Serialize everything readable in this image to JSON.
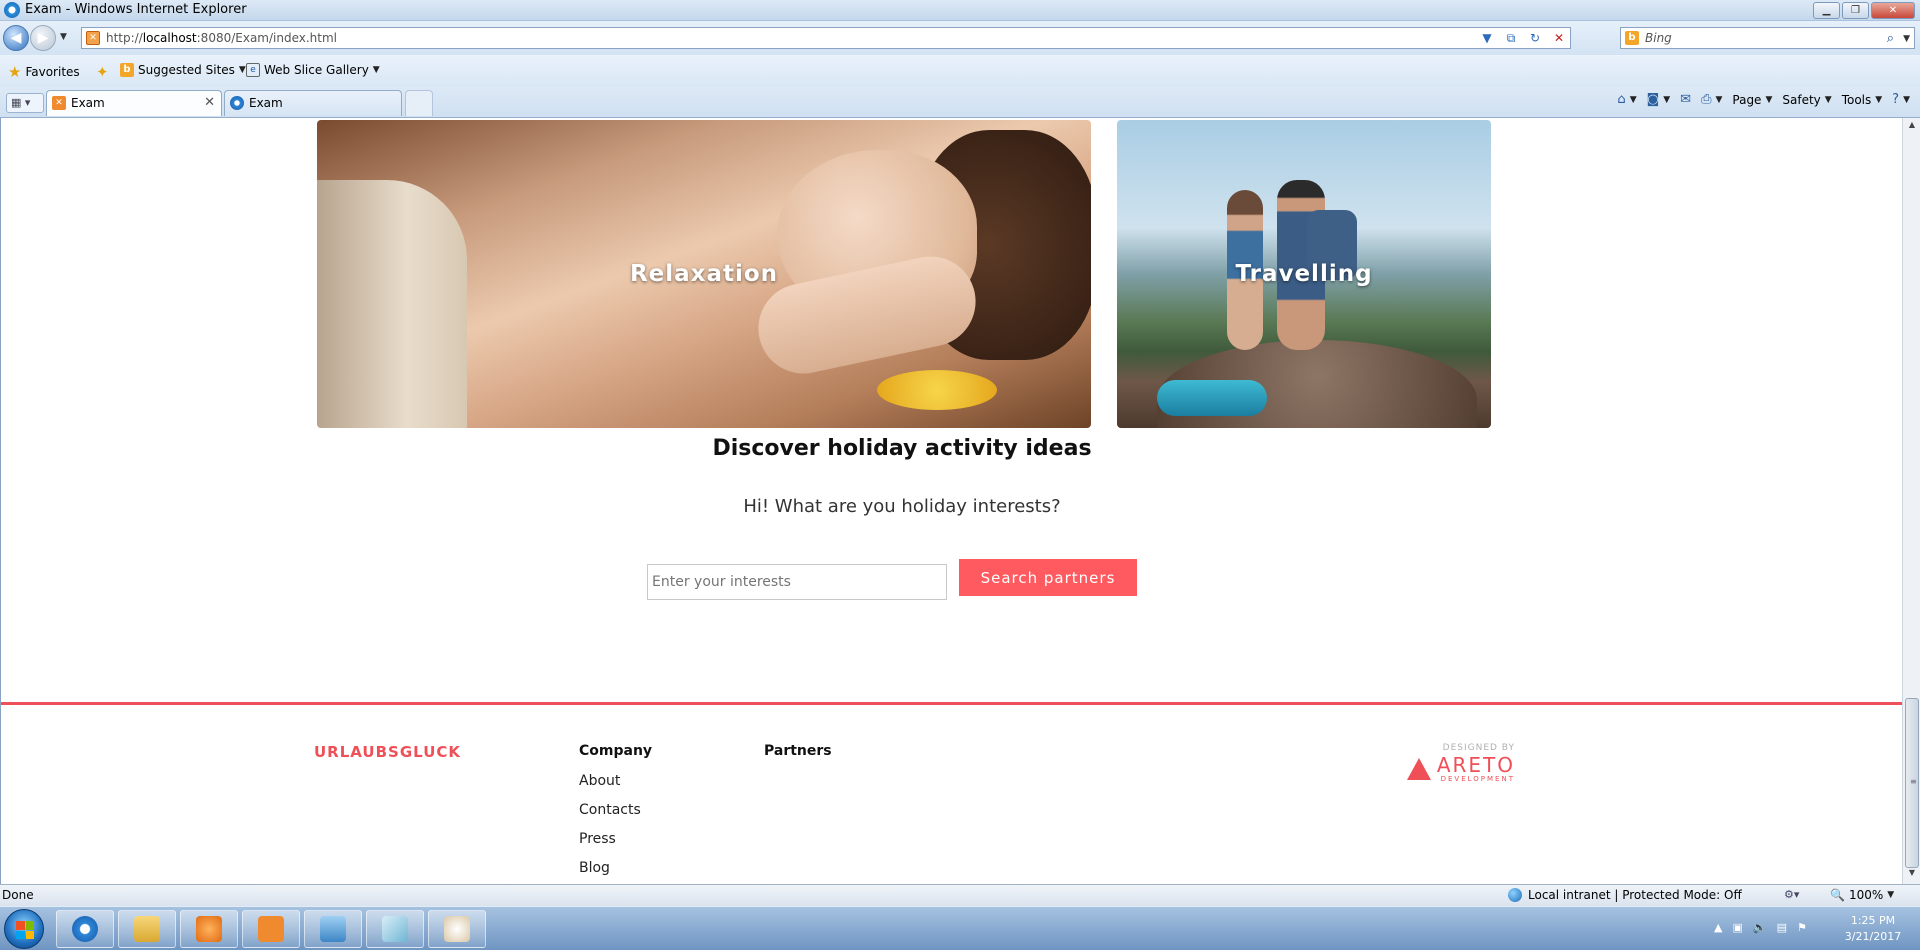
{
  "window": {
    "title": "Exam - Windows Internet Explorer"
  },
  "window_buttons": [
    "▁",
    "❐",
    "✕"
  ],
  "address": {
    "prefix": "http://",
    "host": "localhost",
    "path": ":8080/Exam/index.html"
  },
  "search": {
    "placeholder": "Bing"
  },
  "favorites": {
    "label": "Favorites",
    "items": [
      "Suggested Sites",
      "Web Slice Gallery"
    ]
  },
  "tabs": [
    {
      "label": "Exam",
      "active": true
    },
    {
      "label": "Exam",
      "active": false
    }
  ],
  "commandbar": {
    "page": "Page",
    "safety": "Safety",
    "tools": "Tools"
  },
  "page": {
    "cards": [
      {
        "label": "Relaxation"
      },
      {
        "label": "Travelling"
      }
    ],
    "heading": "Discover holiday activity ideas",
    "subheading": "Hi! What are you holiday interests?",
    "interests_input": {
      "placeholder": "Enter your interests"
    },
    "search_button": "Search partners"
  },
  "footer": {
    "brand": "URLAUBSGLUCK",
    "company": {
      "title": "Company",
      "links": [
        "About",
        "Contacts",
        "Press",
        "Blog"
      ]
    },
    "partners": {
      "title": "Partners"
    },
    "designed_by": "DESIGNED BY",
    "designer_name": "ARETO",
    "designer_sub": "DEVELOPMENT"
  },
  "statusbar": {
    "text": "Done",
    "zone": "Local intranet | Protected Mode: Off",
    "zoom": "100%"
  },
  "clock": {
    "time": "1:25 PM",
    "date": "3/21/2017"
  },
  "colors": {
    "accent": "#ff5a5f",
    "brand": "#ef4f57"
  }
}
